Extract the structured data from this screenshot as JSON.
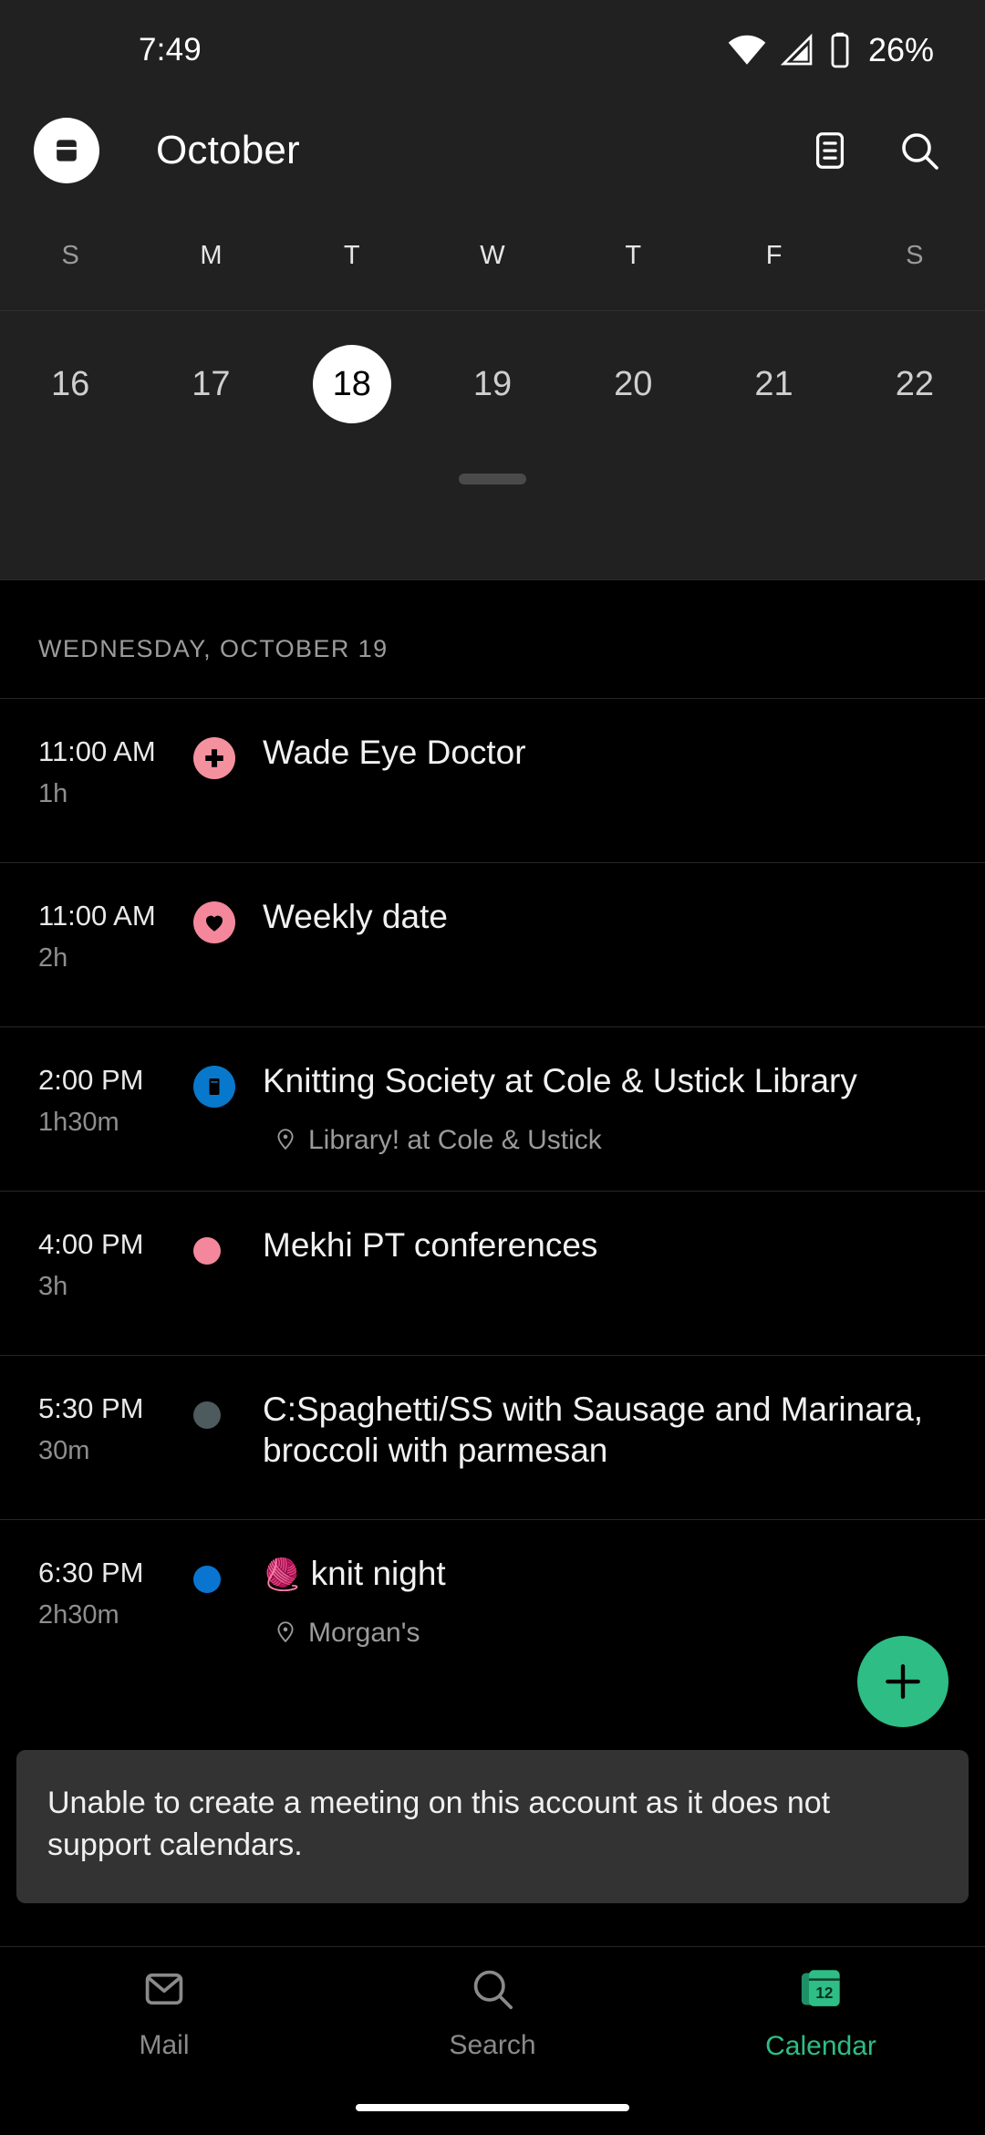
{
  "status_bar": {
    "time": "7:49",
    "battery_percent": "26%",
    "wifi_icon": "wifi-icon",
    "signal_icon": "cell-signal-icon",
    "battery_icon": "battery-icon"
  },
  "header": {
    "drawer_icon": "account-drawer-icon",
    "title": "October",
    "agenda_view_icon": "agenda-view-icon",
    "search_icon": "search-icon"
  },
  "week_strip": {
    "day_initials": [
      "S",
      "M",
      "T",
      "W",
      "T",
      "F",
      "S"
    ],
    "dates": [
      {
        "day": "16",
        "selected": false
      },
      {
        "day": "17",
        "selected": false
      },
      {
        "day": "18",
        "selected": true
      },
      {
        "day": "19",
        "selected": false
      },
      {
        "day": "20",
        "selected": false
      },
      {
        "day": "21",
        "selected": false
      },
      {
        "day": "22",
        "selected": false
      }
    ],
    "drag_handle": "drag-handle"
  },
  "agenda": {
    "day_header": "WEDNESDAY, OCTOBER 19",
    "events": [
      {
        "start": "11:00 AM",
        "duration": "1h",
        "title": "Wade Eye Doctor",
        "marker_type": "circle",
        "marker_color": "#F4919E",
        "marker_icon": "medical-cross-icon",
        "location": ""
      },
      {
        "start": "11:00 AM",
        "duration": "2h",
        "title": "Weekly date",
        "marker_type": "circle",
        "marker_color": "#F4879B",
        "marker_icon": "heart-icon",
        "location": ""
      },
      {
        "start": "2:00 PM",
        "duration": "1h30m",
        "title": "Knitting Society at Cole & Ustick Library",
        "marker_type": "circle",
        "marker_color": "#0878CC",
        "marker_icon": "book-icon",
        "location": "Library! at Cole & Ustick"
      },
      {
        "start": "4:00 PM",
        "duration": "3h",
        "title": "Mekhi PT conferences",
        "marker_type": "dot",
        "marker_color": "#F4879B",
        "marker_icon": "",
        "location": ""
      },
      {
        "start": "5:30 PM",
        "duration": "30m",
        "title": "C:Spaghetti/SS with Sausage and Marinara, broccoli with parmesan",
        "marker_type": "dot",
        "marker_color": "#4D5A5E",
        "marker_icon": "",
        "location": ""
      },
      {
        "start": "6:30 PM",
        "duration": "2h30m",
        "title": "knit night",
        "title_emoji": "🧶",
        "marker_type": "dot",
        "marker_color": "#0A74D1",
        "marker_icon": "",
        "location": "Morgan's"
      }
    ],
    "location_icon": "map-pin-icon"
  },
  "fab": {
    "icon": "plus-icon",
    "color": "#2ebd85",
    "label": "Create event"
  },
  "snackbar": {
    "message": "Unable to create a meeting on this account as it does not support calendars."
  },
  "bottom_nav": {
    "items": [
      {
        "label": "Mail",
        "icon": "mail-icon",
        "active": false
      },
      {
        "label": "Search",
        "icon": "search-icon",
        "active": false
      },
      {
        "label": "Calendar",
        "icon": "calendar-icon",
        "active": true,
        "badge_day": "12"
      }
    ],
    "active_color": "#2ebd85",
    "inactive_color": "#8a8a8a"
  }
}
